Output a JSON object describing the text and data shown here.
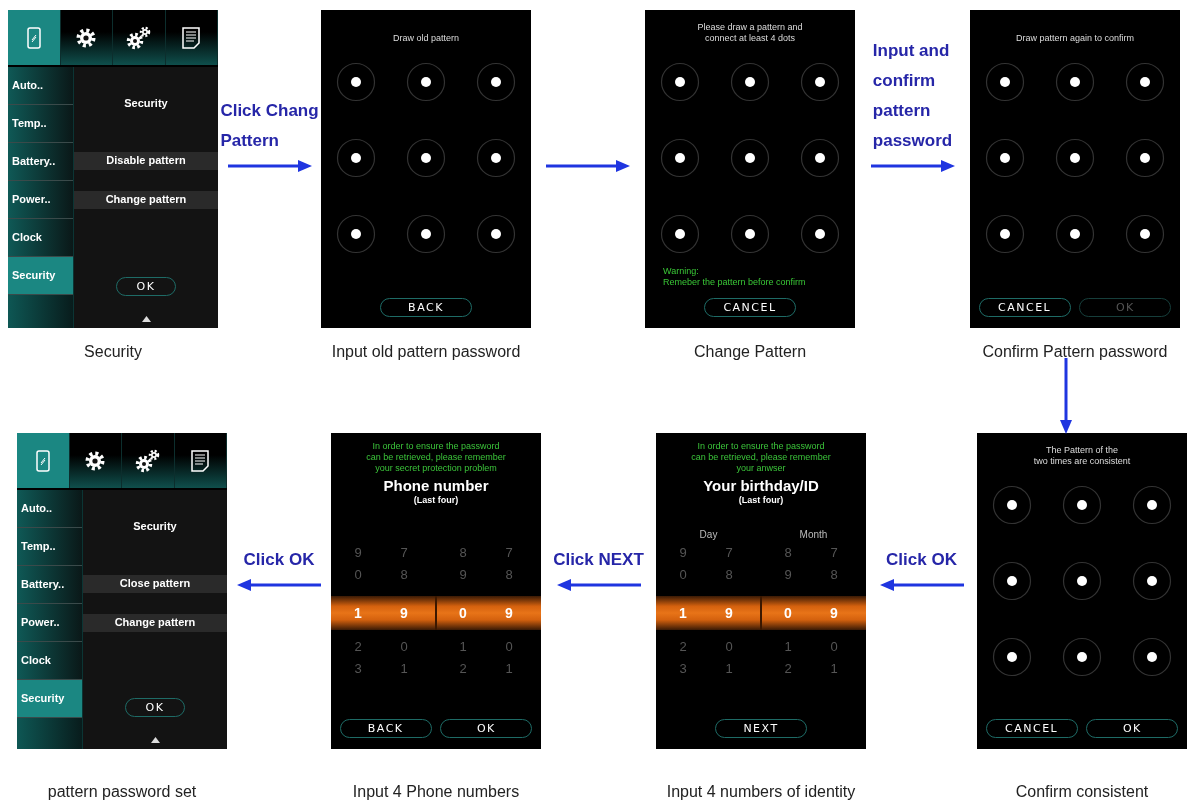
{
  "rows": [
    {
      "items": [
        {
          "kind": "screen",
          "caption": "Security",
          "screen": {
            "kind": "settings",
            "tabs": [
              {
                "selected": true
              },
              {
                "selected": false
              },
              {
                "selected": false
              },
              {
                "selected": false
              }
            ],
            "sidebar": [
              {
                "label": "Auto..",
                "selected": false
              },
              {
                "label": "Temp..",
                "selected": false
              },
              {
                "label": "Battery..",
                "selected": false
              },
              {
                "label": "Power..",
                "selected": false
              },
              {
                "label": "Clock",
                "selected": false
              },
              {
                "label": "Security",
                "selected": true
              }
            ],
            "title": "Security",
            "options": [
              "Disable pattern",
              "Change pattern"
            ],
            "buttons": [
              {
                "label": "OK",
                "disabled": false
              }
            ]
          }
        },
        {
          "kind": "right_arrow",
          "label": [
            "Click Chang",
            "Pattern"
          ]
        },
        {
          "kind": "screen",
          "caption": "Input old pattern password",
          "screen": {
            "kind": "pattern",
            "message": [
              "Draw old pattern"
            ],
            "buttons": [
              {
                "label": "BACK",
                "disabled": false
              }
            ]
          }
        },
        {
          "kind": "right_arrow"
        },
        {
          "kind": "screen",
          "caption": "Change Pattern",
          "screen": {
            "kind": "pattern",
            "message": [
              "Please draw a pattern and",
              "connect at least 4 dots"
            ],
            "warning": [
              "Warning:",
              "Remeber the pattern before confirm"
            ],
            "buttons": [
              {
                "label": "CANCEL",
                "disabled": false
              }
            ]
          }
        },
        {
          "kind": "right_arrow",
          "label": [
            "Input and",
            "confirm",
            "pattern",
            "password"
          ]
        },
        {
          "kind": "screen",
          "caption": "Confirm Pattern password",
          "screen": {
            "kind": "pattern",
            "message": [
              "Draw pattern again to confirm"
            ],
            "buttons": [
              {
                "label": "CANCEL",
                "disabled": false
              },
              {
                "label": "OK",
                "disabled": true
              }
            ]
          }
        }
      ]
    },
    {
      "items": [
        {
          "kind": "screen",
          "caption": "pattern password set",
          "screen": {
            "kind": "settings",
            "tabs": [
              {
                "selected": true
              },
              {
                "selected": false
              },
              {
                "selected": false
              },
              {
                "selected": false
              }
            ],
            "sidebar": [
              {
                "label": "Auto..",
                "selected": false
              },
              {
                "label": "Temp..",
                "selected": false
              },
              {
                "label": "Battery..",
                "selected": false
              },
              {
                "label": "Power..",
                "selected": false
              },
              {
                "label": "Clock",
                "selected": false
              },
              {
                "label": "Security",
                "selected": true
              }
            ],
            "title": "Security",
            "options": [
              "Close pattern",
              "Change pattern"
            ],
            "buttons": [
              {
                "label": "OK",
                "disabled": false
              }
            ]
          }
        },
        {
          "kind": "left_arrow",
          "label": [
            "Click OK"
          ]
        },
        {
          "kind": "screen",
          "caption": "Input 4 Phone numbers",
          "screen": {
            "kind": "picker",
            "notice": [
              "In order to ensure the password",
              "can be retrieved, please remember",
              "your secret protection problem"
            ],
            "heading": "Phone number",
            "subheading": "(Last four)",
            "wheels": [
              {
                "above": [
                  "9",
                  "0"
                ],
                "value": "1",
                "below": [
                  "2",
                  "3"
                ]
              },
              {
                "above": [
                  "7",
                  "8"
                ],
                "value": "9",
                "below": [
                  "0",
                  "1"
                ]
              },
              {
                "above": [
                  "8",
                  "9"
                ],
                "value": "0",
                "below": [
                  "1",
                  "2"
                ]
              },
              {
                "above": [
                  "7",
                  "8"
                ],
                "value": "9",
                "below": [
                  "0",
                  "1"
                ]
              }
            ],
            "buttons": [
              {
                "label": "BACK",
                "disabled": false
              },
              {
                "label": "OK",
                "disabled": false
              }
            ]
          }
        },
        {
          "kind": "left_arrow",
          "label": [
            "Click NEXT"
          ]
        },
        {
          "kind": "screen",
          "caption": "Input 4 numbers of identity",
          "screen": {
            "kind": "picker",
            "notice": [
              "In order to ensure the password",
              "can be retrieved, please remember",
              "your anwser"
            ],
            "heading": "Your birthday/ID",
            "subheading": "(Last four)",
            "wheel_labels": [
              "Day",
              "Month"
            ],
            "wheels": [
              {
                "above": [
                  "9",
                  "0"
                ],
                "value": "1",
                "below": [
                  "2",
                  "3"
                ]
              },
              {
                "above": [
                  "7",
                  "8"
                ],
                "value": "9",
                "below": [
                  "0",
                  "1"
                ]
              },
              {
                "above": [
                  "8",
                  "9"
                ],
                "value": "0",
                "below": [
                  "1",
                  "2"
                ]
              },
              {
                "above": [
                  "7",
                  "8"
                ],
                "value": "9",
                "below": [
                  "0",
                  "1"
                ]
              }
            ],
            "buttons": [
              {
                "label": "NEXT",
                "disabled": false
              }
            ]
          }
        },
        {
          "kind": "left_arrow",
          "label": [
            "Click OK"
          ]
        },
        {
          "kind": "screen",
          "caption": "Confirm consistent",
          "screen": {
            "kind": "pattern",
            "message": [
              "The Pattern of the",
              "two times are consistent"
            ],
            "buttons": [
              {
                "label": "CANCEL",
                "disabled": false
              },
              {
                "label": "OK",
                "disabled": false
              }
            ]
          }
        }
      ]
    }
  ],
  "connectors": [
    {
      "kind": "down_arrow"
    }
  ]
}
